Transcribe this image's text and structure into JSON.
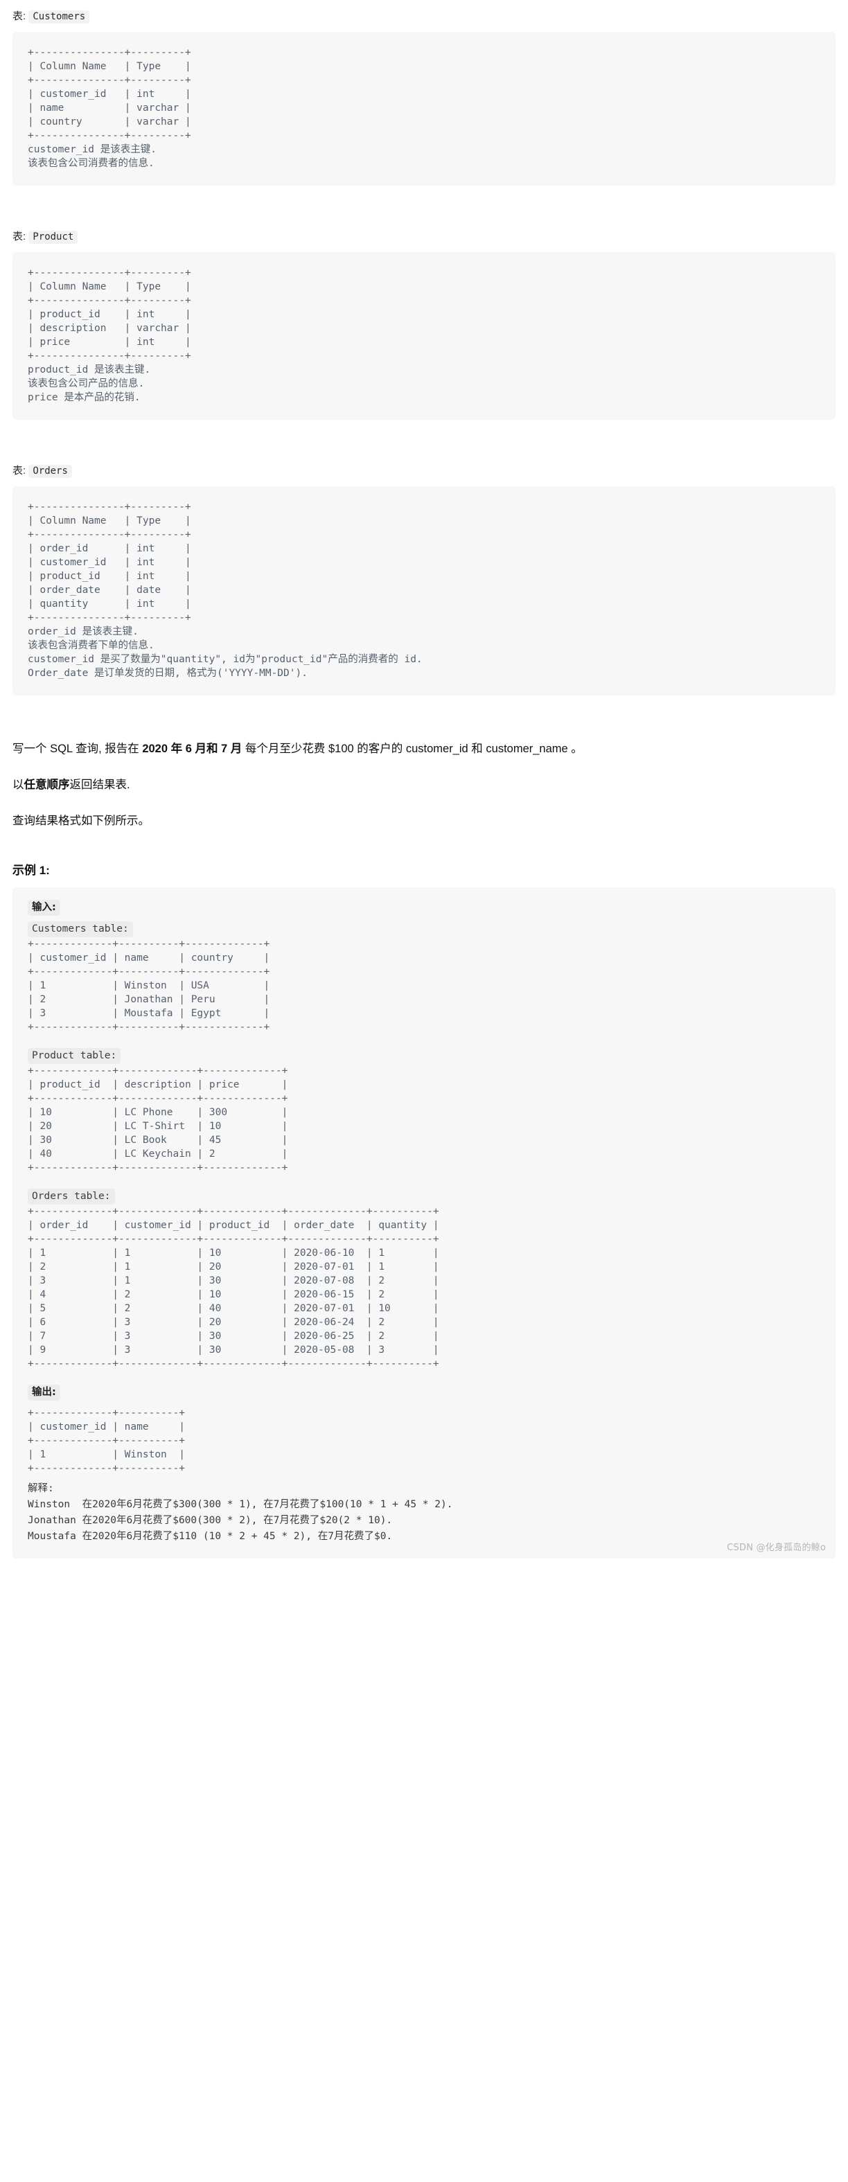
{
  "schema_sections": [
    {
      "caption_prefix": "表:",
      "table_name": "Customers",
      "code": "+---------------+---------+\n| Column Name   | Type    |\n+---------------+---------+\n| customer_id   | int     |\n| name          | varchar |\n| country       | varchar |\n+---------------+---------+\ncustomer_id 是该表主键.\n该表包含公司消费者的信息."
    },
    {
      "caption_prefix": "表:",
      "table_name": "Product",
      "code": "+---------------+---------+\n| Column Name   | Type    |\n+---------------+---------+\n| product_id    | int     |\n| description   | varchar |\n| price         | int     |\n+---------------+---------+\nproduct_id 是该表主键.\n该表包含公司产品的信息.\nprice 是本产品的花销."
    },
    {
      "caption_prefix": "表:",
      "table_name": "Orders",
      "code": "+---------------+---------+\n| Column Name   | Type    |\n+---------------+---------+\n| order_id      | int     |\n| customer_id   | int     |\n| product_id    | int     |\n| order_date    | date    |\n| quantity      | int     |\n+---------------+---------+\norder_id 是该表主键.\n该表包含消费者下单的信息.\ncustomer_id 是买了数量为\"quantity\", id为\"product_id\"产品的消费者的 id.\nOrder_date 是订单发货的日期, 格式为('YYYY-MM-DD')."
    }
  ],
  "question": {
    "line1_a": "写一个 SQL 查询, 报告在 ",
    "line1_bold": "2020 年 6 月和 7 月",
    "line1_b": " 每个月至少花费 $100 的客户的 customer_id 和 customer_name 。",
    "line2_a": "以",
    "line2_bold": "任意顺序",
    "line2_b": "返回结果表.",
    "line3": "查询结果格式如下例所示。"
  },
  "example": {
    "title": "示例 1:",
    "input_label": "输入:",
    "customers_label": "Customers table:",
    "customers_code": "+-------------+----------+-------------+\n| customer_id | name     | country     |\n+-------------+----------+-------------+\n| 1           | Winston  | USA         |\n| 2           | Jonathan | Peru        |\n| 3           | Moustafa | Egypt       |\n+-------------+----------+-------------+",
    "product_label": "Product table:",
    "product_code": "+-------------+-------------+-------------+\n| product_id  | description | price       |\n+-------------+-------------+-------------+\n| 10          | LC Phone    | 300         |\n| 20          | LC T-Shirt  | 10          |\n| 30          | LC Book     | 45          |\n| 40          | LC Keychain | 2           |\n+-------------+-------------+-------------+",
    "orders_label": "Orders table:",
    "orders_code": "+-------------+-------------+-------------+-------------+----------+\n| order_id    | customer_id | product_id  | order_date  | quantity |\n+-------------+-------------+-------------+-------------+----------+\n| 1           | 1           | 10          | 2020-06-10  | 1        |\n| 2           | 1           | 20          | 2020-07-01  | 1        |\n| 3           | 1           | 30          | 2020-07-08  | 2        |\n| 4           | 2           | 10          | 2020-06-15  | 2        |\n| 5           | 2           | 40          | 2020-07-01  | 10       |\n| 6           | 3           | 20          | 2020-06-24  | 2        |\n| 7           | 3           | 30          | 2020-06-25  | 2        |\n| 9           | 3           | 30          | 2020-05-08  | 3        |\n+-------------+-------------+-------------+-------------+----------+",
    "output_label": "输出:",
    "output_code": "+-------------+----------+\n| customer_id | name     |\n+-------------+----------+\n| 1           | Winston  |\n+-------------+----------+",
    "explanation_label": "解释:",
    "explanation_code": "Winston  在2020年6月花费了$300(300 * 1), 在7月花费了$100(10 * 1 + 45 * 2).\nJonathan 在2020年6月花费了$600(300 * 2), 在7月花费了$20(2 * 10).\nMoustafa 在2020年6月花费了$110 (10 * 2 + 45 * 2), 在7月花费了$0."
  },
  "watermark": "CSDN @化身孤岛的鲸o",
  "colors": {
    "code_bg": "#f7f7f7",
    "inline_code_bg": "#ececec",
    "code_text": "#55606e",
    "body_text": "#111111",
    "watermark": "#b5b5b5"
  }
}
